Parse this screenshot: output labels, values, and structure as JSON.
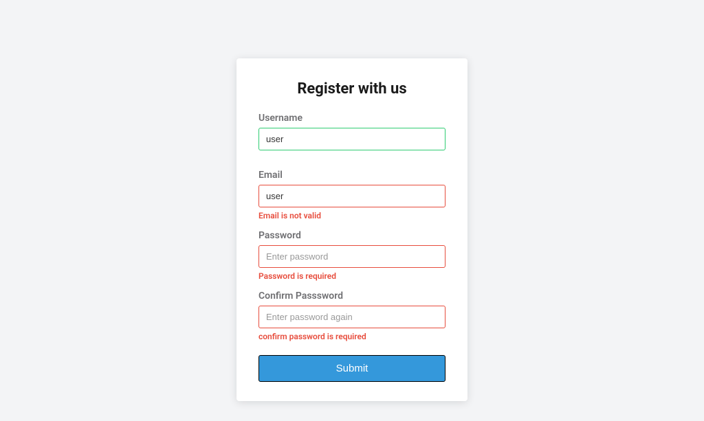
{
  "form": {
    "title": "Register with us",
    "username": {
      "label": "Username",
      "value": "user",
      "placeholder": "",
      "state": "valid"
    },
    "email": {
      "label": "Email",
      "value": "user",
      "placeholder": "",
      "state": "invalid",
      "error": "Email is not valid"
    },
    "password": {
      "label": "Password",
      "value": "",
      "placeholder": "Enter password",
      "state": "invalid",
      "error": "Password is required"
    },
    "confirmPassword": {
      "label": "Confirm Passsword",
      "value": "",
      "placeholder": "Enter password again",
      "state": "invalid",
      "error": "confirm password is required"
    },
    "submitLabel": "Submit"
  }
}
